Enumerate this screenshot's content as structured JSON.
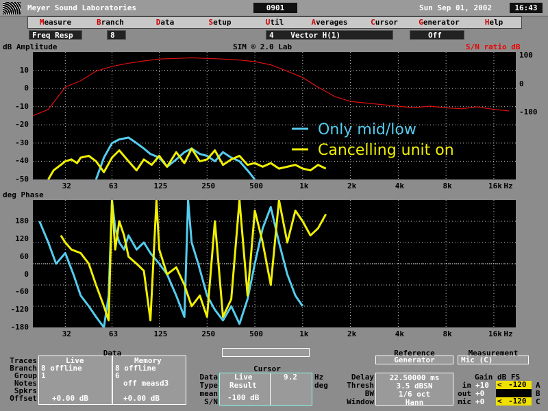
{
  "title_bar": {
    "app_title": "Meyer Sound Laboratories",
    "doc_id": "0901",
    "date": "Sun Sep 01, 2002",
    "time": "16:43"
  },
  "menu": [
    {
      "hot": "M",
      "rest": "easure"
    },
    {
      "hot": "B",
      "rest": "ranch"
    },
    {
      "hot": "D",
      "rest": "ata"
    },
    {
      "hot": "S",
      "rest": "etup"
    },
    {
      "hot": "U",
      "rest": "til"
    },
    {
      "hot": "A",
      "rest": "verages"
    },
    {
      "hot": "C",
      "rest": "ursor"
    },
    {
      "hot": "G",
      "rest": "enerator"
    },
    {
      "hot": "H",
      "rest": "elp"
    }
  ],
  "status": {
    "mode": "Freq Resp",
    "branch": "8",
    "vector_num": "4",
    "vector_label": "Vector H(1)",
    "gen_state": "Off"
  },
  "amp_panel": {
    "ylabel": "dB Amplitude",
    "center_title": "SIM ® 2.0 Lab",
    "right_label": "S/N ratio dB",
    "yticks": [
      "10",
      "0",
      "-10",
      "-20",
      "-30",
      "-40",
      "-50"
    ],
    "right_ticks": [
      "100",
      "0",
      "-100"
    ]
  },
  "phase_panel": {
    "ylabel": "deg Phase",
    "yticks": [
      "180",
      "120",
      "60",
      "0",
      "-60",
      "-120",
      "-180"
    ]
  },
  "x_ticks": [
    "32",
    "63",
    "125",
    "250",
    "500",
    "1k",
    "2k",
    "4k",
    "8k",
    "16k",
    "Hz"
  ],
  "legend": [
    {
      "label": "Only mid/low",
      "color": "#55ccee"
    },
    {
      "label": "Cancelling unit on",
      "color": "#f0f000"
    }
  ],
  "colors": {
    "sn_trace": "#e01010",
    "cyan": "#55ccee",
    "yellow": "#f0f000",
    "grid": "#c8c8c8"
  },
  "chart_data": [
    {
      "type": "line",
      "title": "",
      "xlabel": "Hz",
      "ylabel": "dB Amplitude",
      "xscale": "log",
      "xlim": [
        20,
        22000
      ],
      "ylim": [
        -50,
        20
      ],
      "series": [
        {
          "name": "Only mid/low",
          "x": [
            50,
            56,
            63,
            70,
            80,
            90,
            100,
            110,
            125,
            140,
            160,
            180,
            200,
            225,
            250,
            280,
            315,
            355,
            400,
            450,
            500
          ],
          "y": [
            -50,
            -38,
            -30,
            -28,
            -27,
            -30,
            -33,
            -36,
            -38,
            -43,
            -39,
            -35,
            -33,
            -36,
            -37,
            -40,
            -35,
            -38,
            -40,
            -45,
            -50
          ]
        },
        {
          "name": "Cancelling unit on",
          "x": [
            25,
            27,
            30,
            32,
            35,
            38,
            40,
            45,
            50,
            56,
            63,
            70,
            80,
            90,
            100,
            112,
            125,
            140,
            160,
            180,
            200,
            225,
            250,
            280,
            315,
            355,
            400,
            450,
            500,
            560,
            630,
            710,
            800,
            900,
            1000,
            1120,
            1250,
            1400
          ],
          "y": [
            -50,
            -45,
            -42,
            -40,
            -39,
            -41,
            -38,
            -37,
            -40,
            -46,
            -38,
            -34,
            -40,
            -45,
            -39,
            -42,
            -37,
            -43,
            -35,
            -41,
            -33,
            -40,
            -39,
            -34,
            -42,
            -39,
            -37,
            -42,
            -41,
            -43,
            -41,
            -44,
            -43,
            -42,
            -44,
            -45,
            -42,
            -44
          ]
        }
      ]
    },
    {
      "type": "line",
      "title": "",
      "xlabel": "Hz",
      "ylabel": "S/N ratio dB",
      "xscale": "log",
      "xlim": [
        20,
        22000
      ],
      "ylim": [
        -100,
        100
      ],
      "series": [
        {
          "name": "",
          "x": [
            20,
            25,
            32,
            40,
            50,
            63,
            80,
            100,
            125,
            160,
            200,
            250,
            315,
            400,
            500,
            630,
            800,
            1000,
            1250,
            1600,
            2000,
            2500,
            3150,
            4000,
            5000,
            6300,
            8000,
            10000,
            12500,
            16000,
            20000
          ],
          "y": [
            -100,
            -80,
            -10,
            10,
            40,
            55,
            65,
            72,
            78,
            80,
            82,
            80,
            78,
            75,
            70,
            60,
            40,
            20,
            -10,
            -40,
            -55,
            -60,
            -65,
            -70,
            -75,
            -70,
            -75,
            -78,
            -72,
            -80,
            -85
          ]
        }
      ]
    },
    {
      "type": "line",
      "title": "",
      "xlabel": "Hz",
      "ylabel": "deg Phase",
      "xscale": "log",
      "xlim": [
        20,
        22000
      ],
      "ylim": [
        -180,
        180
      ],
      "series": [
        {
          "name": "Only mid/low",
          "x": [
            22,
            25,
            28,
            32,
            36,
            40,
            45,
            50,
            56,
            60,
            63,
            66,
            70,
            75,
            80,
            90,
            100,
            110,
            125,
            140,
            160,
            180,
            190,
            200,
            220,
            250,
            280,
            315,
            355,
            400,
            450,
            500,
            560,
            630,
            710,
            800,
            900,
            1000
          ],
          "y": [
            120,
            60,
            0,
            30,
            -30,
            -90,
            -120,
            -150,
            -180,
            -90,
            180,
            100,
            60,
            40,
            80,
            40,
            60,
            30,
            0,
            -30,
            -90,
            -150,
            180,
            60,
            0,
            -90,
            -130,
            -160,
            -120,
            -170,
            -100,
            0,
            100,
            160,
            60,
            -30,
            -90,
            -120
          ]
        },
        {
          "name": "Cancelling unit on",
          "x": [
            30,
            32,
            35,
            40,
            45,
            50,
            56,
            60,
            63,
            66,
            70,
            75,
            80,
            90,
            100,
            110,
            120,
            125,
            140,
            160,
            180,
            200,
            225,
            250,
            280,
            315,
            355,
            400,
            450,
            500,
            560,
            630,
            710,
            800,
            900,
            1000,
            1120,
            1250,
            1400
          ],
          "y": [
            80,
            60,
            40,
            30,
            0,
            -60,
            -120,
            -160,
            180,
            40,
            120,
            80,
            20,
            0,
            -20,
            -160,
            180,
            40,
            -30,
            -10,
            -60,
            -120,
            -90,
            -150,
            120,
            -150,
            -100,
            180,
            -90,
            150,
            60,
            -60,
            180,
            60,
            150,
            120,
            80,
            100,
            140
          ]
        }
      ]
    }
  ],
  "data_panel": {
    "title": "Data",
    "row_labels": [
      "Traces",
      "Branch",
      "Group",
      "Notes",
      "Spkrs",
      "Offset"
    ],
    "live_header": "Live",
    "memory_header": "Memory",
    "live_values": [
      "",
      "8 offline",
      "1",
      "",
      "",
      "+0.00 dB"
    ],
    "memory_values": [
      "",
      "8 offline",
      "6",
      "off measd3",
      "",
      "+0.00 dB"
    ]
  },
  "cursor_panel": {
    "title": "Cursor",
    "row_labels": [
      "Data",
      "Type",
      "mean",
      "S/N"
    ],
    "live": "Live",
    "result": "Result",
    "value": "-100 dB",
    "freq": "9.2",
    "freq_unit": "Hz",
    "deg_unit": "deg"
  },
  "ref_panel": {
    "reference_title": "Reference",
    "reference_value": "Generator",
    "measurement_title": "Measurement",
    "measurement_value": "Mic (C)",
    "labels": [
      "Delay",
      "Thresh",
      "BW",
      "Window"
    ],
    "values": [
      "22.50000 ms",
      "3.5 dBSN",
      "1/6 oct",
      "Hann"
    ]
  },
  "gain_panel": {
    "title": "Gain dB FS",
    "rows": [
      {
        "label": "in",
        "gain": "+10",
        "level": "-120",
        "ch": "A"
      },
      {
        "label": "out",
        "gain": "+0",
        "level": "",
        "ch": "B"
      },
      {
        "label": "mic",
        "gain": "+0",
        "level": "-120",
        "ch": "C"
      }
    ]
  }
}
